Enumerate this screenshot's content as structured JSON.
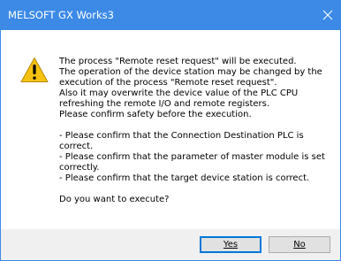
{
  "window": {
    "title": "MELSOFT GX Works3",
    "close_icon": "close-icon",
    "titlebar_color": "#3c8ae6"
  },
  "dialog": {
    "icon": "warning-icon",
    "message_lines": [
      "The process \"Remote reset request\" will be executed.",
      "The operation of the device station may be changed by the",
      "execution of the process \"Remote reset request\".",
      "Also it may overwrite the device value of the PLC CPU",
      "refreshing the remote I/O and remote registers.",
      "Please confirm safety before the execution.",
      "",
      "- Please confirm that the Connection Destination PLC is",
      "correct.",
      "- Please confirm that the parameter of master module is set",
      "correctly.",
      "- Please confirm that the target device station is correct.",
      "",
      "Do you want to execute?"
    ]
  },
  "buttons": {
    "yes_label": "Yes",
    "no_label": "No"
  }
}
